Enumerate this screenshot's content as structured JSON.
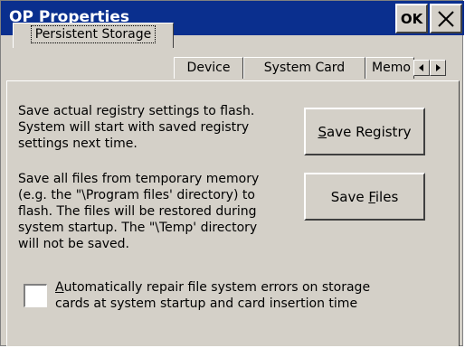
{
  "window": {
    "title": "OP Properties",
    "ok_label": "OK"
  },
  "tabs": [
    {
      "label": "Persistent Storage",
      "active": true
    },
    {
      "label": "Device",
      "active": false
    },
    {
      "label": "System Card",
      "active": false
    },
    {
      "label": "Memo",
      "active": false
    }
  ],
  "tab_scroll": {
    "left_icon": "arrow-left-icon",
    "right_icon": "arrow-right-icon"
  },
  "registry": {
    "description": "Save actual registry settings to flash.\nSystem will start with saved registry\nsettings next time.",
    "button_prefix": "",
    "button_access": "S",
    "button_rest": "ave Registry"
  },
  "files": {
    "description": "Save all files from temporary memory\n(e.g. the \"\\Program files' directory) to\nflash. The files will be restored during\nsystem startup. The \"\\Temp' directory\nwill not be saved.",
    "button_prefix": "Save ",
    "button_access": "F",
    "button_rest": "iles"
  },
  "auto_repair": {
    "checked": false,
    "label_access": "A",
    "label_rest": "utomatically repair file system errors on storage",
    "label_line2": "cards at system startup and card insertion time"
  },
  "colors": {
    "titlebar": "#0a2f8e",
    "face": "#d4d0c8"
  }
}
